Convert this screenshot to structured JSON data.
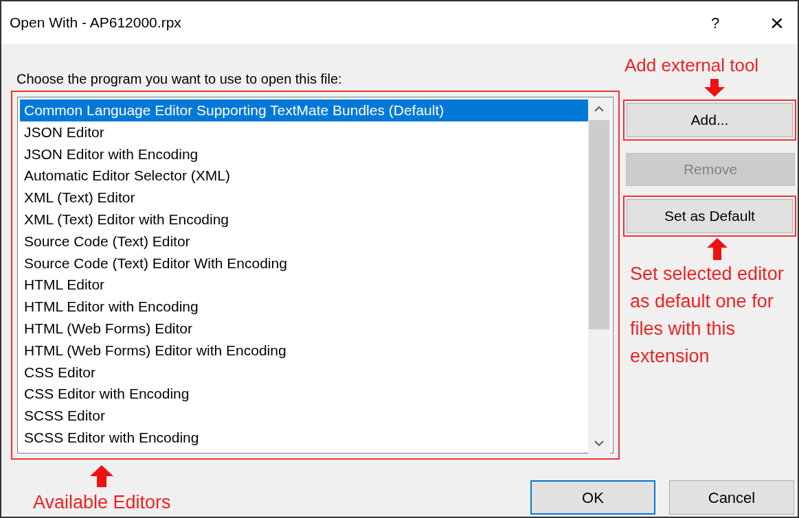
{
  "window": {
    "title": "Open With - AP612000.rpx",
    "help": "?",
    "close": "×"
  },
  "prompt": "Choose the program you want to use to open this file:",
  "editors": [
    {
      "label": "Common Language Editor Supporting TextMate Bundles (Default)",
      "selected": true
    },
    {
      "label": "JSON Editor",
      "selected": false
    },
    {
      "label": "JSON Editor with Encoding",
      "selected": false
    },
    {
      "label": "Automatic Editor Selector (XML)",
      "selected": false
    },
    {
      "label": "XML (Text) Editor",
      "selected": false
    },
    {
      "label": "XML (Text) Editor with Encoding",
      "selected": false
    },
    {
      "label": "Source Code (Text) Editor",
      "selected": false
    },
    {
      "label": "Source Code (Text) Editor With Encoding",
      "selected": false
    },
    {
      "label": "HTML Editor",
      "selected": false
    },
    {
      "label": "HTML Editor with Encoding",
      "selected": false
    },
    {
      "label": "HTML (Web Forms) Editor",
      "selected": false
    },
    {
      "label": "HTML (Web Forms) Editor with Encoding",
      "selected": false
    },
    {
      "label": "CSS Editor",
      "selected": false
    },
    {
      "label": "CSS Editor with Encoding",
      "selected": false
    },
    {
      "label": "SCSS Editor",
      "selected": false
    },
    {
      "label": "SCSS Editor with Encoding",
      "selected": false
    }
  ],
  "side_buttons": [
    {
      "label": "Add...",
      "disabled": false
    },
    {
      "label": "Remove",
      "disabled": true
    },
    {
      "label": "Set as Default",
      "disabled": false
    }
  ],
  "footer_buttons": [
    {
      "label": "OK",
      "default": true
    },
    {
      "label": "Cancel",
      "default": false
    }
  ],
  "annotations": {
    "add": "Add external tool",
    "set_default": "Set selected editor as default one for files with this extension",
    "list": "Available Editors"
  }
}
